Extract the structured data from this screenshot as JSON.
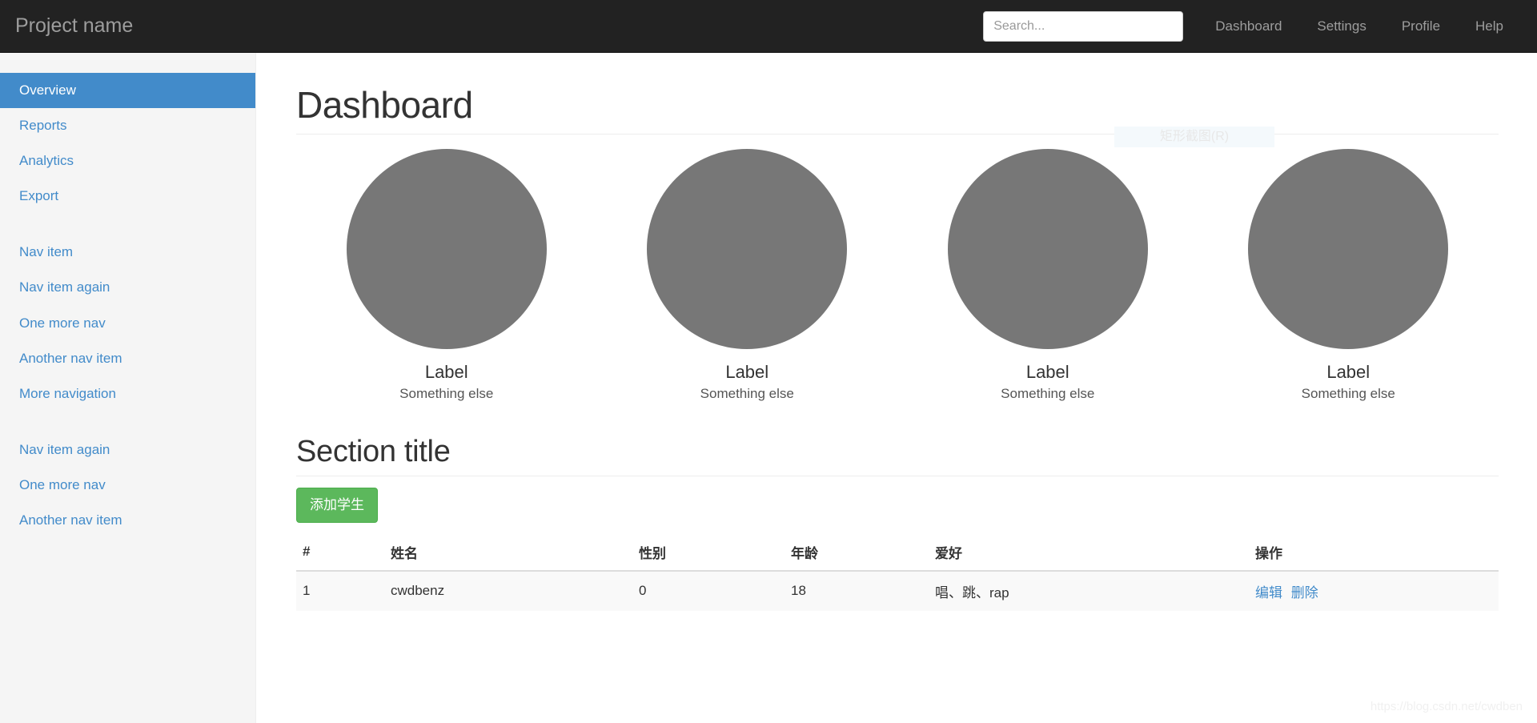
{
  "navbar": {
    "brand": "Project name",
    "search": {
      "placeholder": "Search...",
      "value": ""
    },
    "links": [
      {
        "label": "Dashboard"
      },
      {
        "label": "Settings"
      },
      {
        "label": "Profile"
      },
      {
        "label": "Help"
      }
    ],
    "background_color": "#222222",
    "text_color": "#9d9d9d"
  },
  "sidebar": {
    "background_color": "#f5f5f5",
    "active_color": "#428bca",
    "groups": [
      {
        "items": [
          {
            "label": "Overview",
            "active": true
          },
          {
            "label": "Reports",
            "active": false
          },
          {
            "label": "Analytics",
            "active": false
          },
          {
            "label": "Export",
            "active": false
          }
        ]
      },
      {
        "items": [
          {
            "label": "Nav item",
            "active": false
          },
          {
            "label": "Nav item again",
            "active": false
          },
          {
            "label": "One more nav",
            "active": false
          },
          {
            "label": "Another nav item",
            "active": false
          },
          {
            "label": "More navigation",
            "active": false
          }
        ]
      },
      {
        "items": [
          {
            "label": "Nav item again",
            "active": false
          },
          {
            "label": "One more nav",
            "active": false
          },
          {
            "label": "Another nav item",
            "active": false
          }
        ]
      }
    ]
  },
  "main": {
    "page_title": "Dashboard",
    "placeholders": [
      {
        "label": "Label",
        "subtitle": "Something else",
        "color": "#777777"
      },
      {
        "label": "Label",
        "subtitle": "Something else",
        "color": "#777777"
      },
      {
        "label": "Label",
        "subtitle": "Something else",
        "color": "#777777"
      },
      {
        "label": "Label",
        "subtitle": "Something else",
        "color": "#777777"
      }
    ],
    "ghost_tooltip": "矩形截图(R)",
    "section_title": "Section title",
    "add_button": {
      "label": "添加学生",
      "color": "#5cb85c"
    },
    "table": {
      "headers": [
        "#",
        "姓名",
        "性别",
        "年龄",
        "爱好",
        "操作"
      ],
      "rows": [
        {
          "index": "1",
          "name": "cwdbenz",
          "gender": "0",
          "age": "18",
          "hobby": "唱、跳、rap",
          "edit": "编辑",
          "delete": "删除"
        }
      ]
    }
  },
  "watermark": "https://blog.csdn.net/cwdben"
}
